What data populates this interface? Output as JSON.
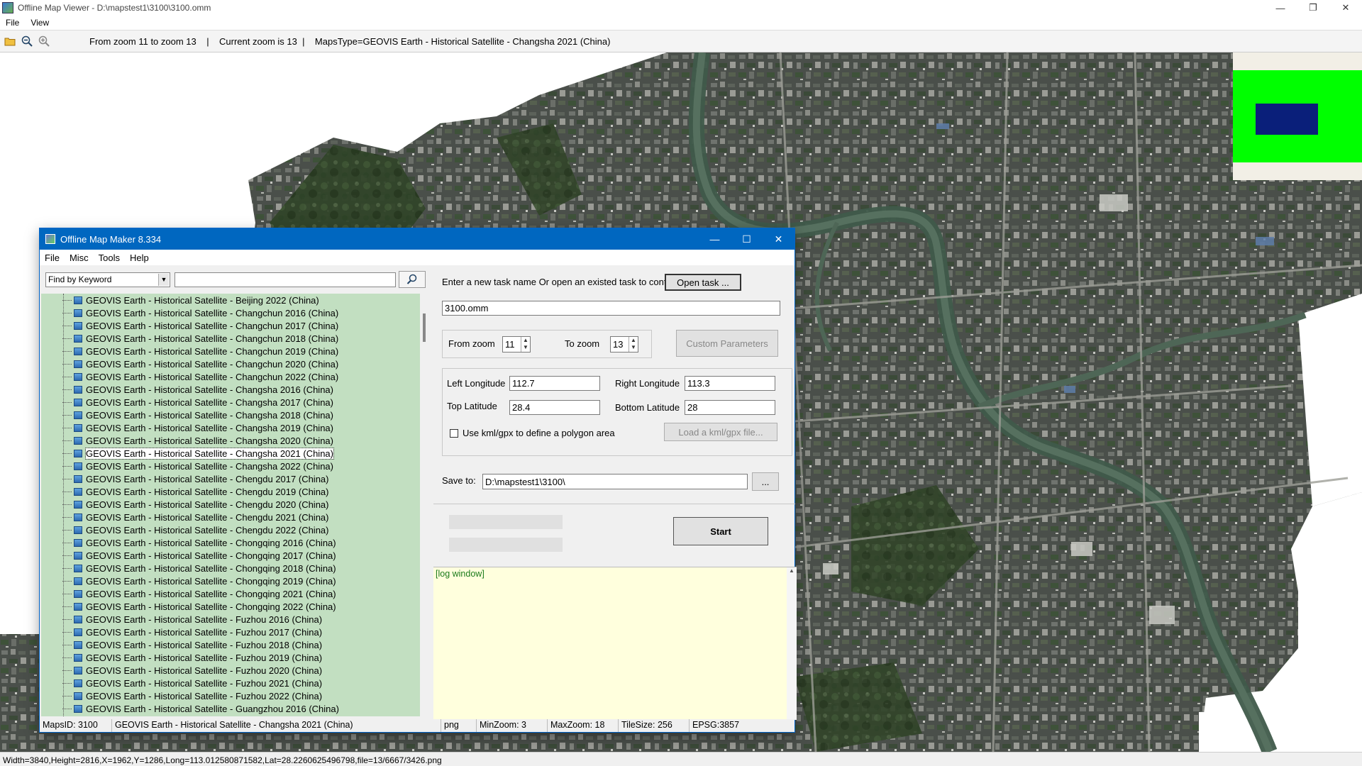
{
  "window": {
    "title": "Offline Map Viewer - D:\\mapstest1\\3100\\3100.omm",
    "minimize": "—",
    "maximize": "❐",
    "close": "✕"
  },
  "menu": [
    "File",
    "View"
  ],
  "toolbar": {
    "info": "From zoom 11 to zoom 13    |    Current zoom is 13  |    MapsType=GEOVIS Earth - Historical Satellite - Changsha 2021 (China)"
  },
  "status": {
    "text": "Width=3840,Height=2816,X=1962,Y=1286,Long=113.012580871582,Lat=28.2260625496798,file=13/6667/3426.png"
  },
  "dialog": {
    "title": "Offline Map Maker 8.334",
    "menu": [
      "File",
      "Misc",
      "Tools",
      "Help"
    ],
    "search": {
      "mode": "Find by Keyword",
      "value": ""
    },
    "tree_items": [
      "GEOVIS Earth - Historical Satellite - Beijing 2022 (China)",
      "GEOVIS Earth - Historical Satellite - Changchun 2016 (China)",
      "GEOVIS Earth - Historical Satellite - Changchun 2017 (China)",
      "GEOVIS Earth - Historical Satellite - Changchun 2018 (China)",
      "GEOVIS Earth - Historical Satellite - Changchun 2019 (China)",
      "GEOVIS Earth - Historical Satellite - Changchun 2020 (China)",
      "GEOVIS Earth - Historical Satellite - Changchun 2022 (China)",
      "GEOVIS Earth - Historical Satellite - Changsha 2016 (China)",
      "GEOVIS Earth - Historical Satellite - Changsha 2017 (China)",
      "GEOVIS Earth - Historical Satellite - Changsha 2018 (China)",
      "GEOVIS Earth - Historical Satellite - Changsha 2019 (China)",
      "GEOVIS Earth - Historical Satellite - Changsha 2020 (China)",
      "GEOVIS Earth - Historical Satellite - Changsha 2021 (China)",
      "GEOVIS Earth - Historical Satellite - Changsha 2022 (China)",
      "GEOVIS Earth - Historical Satellite - Chengdu 2017 (China)",
      "GEOVIS Earth - Historical Satellite - Chengdu 2019 (China)",
      "GEOVIS Earth - Historical Satellite - Chengdu 2020 (China)",
      "GEOVIS Earth - Historical Satellite - Chengdu 2021 (China)",
      "GEOVIS Earth - Historical Satellite - Chengdu 2022 (China)",
      "GEOVIS Earth - Historical Satellite - Chongqing 2016 (China)",
      "GEOVIS Earth - Historical Satellite - Chongqing 2017 (China)",
      "GEOVIS Earth - Historical Satellite - Chongqing 2018 (China)",
      "GEOVIS Earth - Historical Satellite - Chongqing 2019 (China)",
      "GEOVIS Earth - Historical Satellite - Chongqing 2021 (China)",
      "GEOVIS Earth - Historical Satellite - Chongqing 2022 (China)",
      "GEOVIS Earth - Historical Satellite - Fuzhou 2016 (China)",
      "GEOVIS Earth - Historical Satellite - Fuzhou 2017 (China)",
      "GEOVIS Earth - Historical Satellite - Fuzhou 2018 (China)",
      "GEOVIS Earth - Historical Satellite - Fuzhou 2019 (China)",
      "GEOVIS Earth - Historical Satellite - Fuzhou 2020 (China)",
      "GEOVIS Earth - Historical Satellite - Fuzhou 2021 (China)",
      "GEOVIS Earth - Historical Satellite - Fuzhou 2022 (China)",
      "GEOVIS Earth - Historical Satellite - Guangzhou 2016 (China)"
    ],
    "selected_index": 12,
    "prompt": "Enter a new task name Or open an existed task to continue:",
    "open_task": "Open task ...",
    "task_name": "3100.omm",
    "from_zoom_label": "From zoom",
    "from_zoom": "11",
    "to_zoom_label": "To zoom",
    "to_zoom": "13",
    "custom_params": "Custom Parameters",
    "left_lon_label": "Left Longitude",
    "left_lon": "112.7",
    "right_lon_label": "Right Longitude",
    "right_lon": "113.3",
    "top_lat_label": "Top Latitude",
    "top_lat": "28.4",
    "bottom_lat_label": "Bottom Latitude",
    "bottom_lat": "28",
    "kml_label": "Use kml/gpx to define a polygon area",
    "kml_checked": false,
    "load_kml": "Load a kml/gpx file...",
    "save_to_label": "Save to:",
    "save_to": "D:\\mapstest1\\3100\\",
    "browse": "...",
    "start": "Start",
    "log": "[log window]",
    "statusbar": {
      "maps_id": "MapsID: 3100",
      "maps_name": "GEOVIS Earth - Historical Satellite - Changsha 2021 (China)",
      "format": "png",
      "min_zoom": "MinZoom: 3",
      "max_zoom": "MaxZoom: 18",
      "tile_size": "TileSize: 256",
      "epsg": "EPSG:3857"
    }
  },
  "colors": {
    "dialog_title": "#0067c0",
    "tree_bg": "#c2dfc1",
    "log_bg": "#ffffdd",
    "overview_green": "#00ff00",
    "overview_navy": "#0a1f7a"
  }
}
